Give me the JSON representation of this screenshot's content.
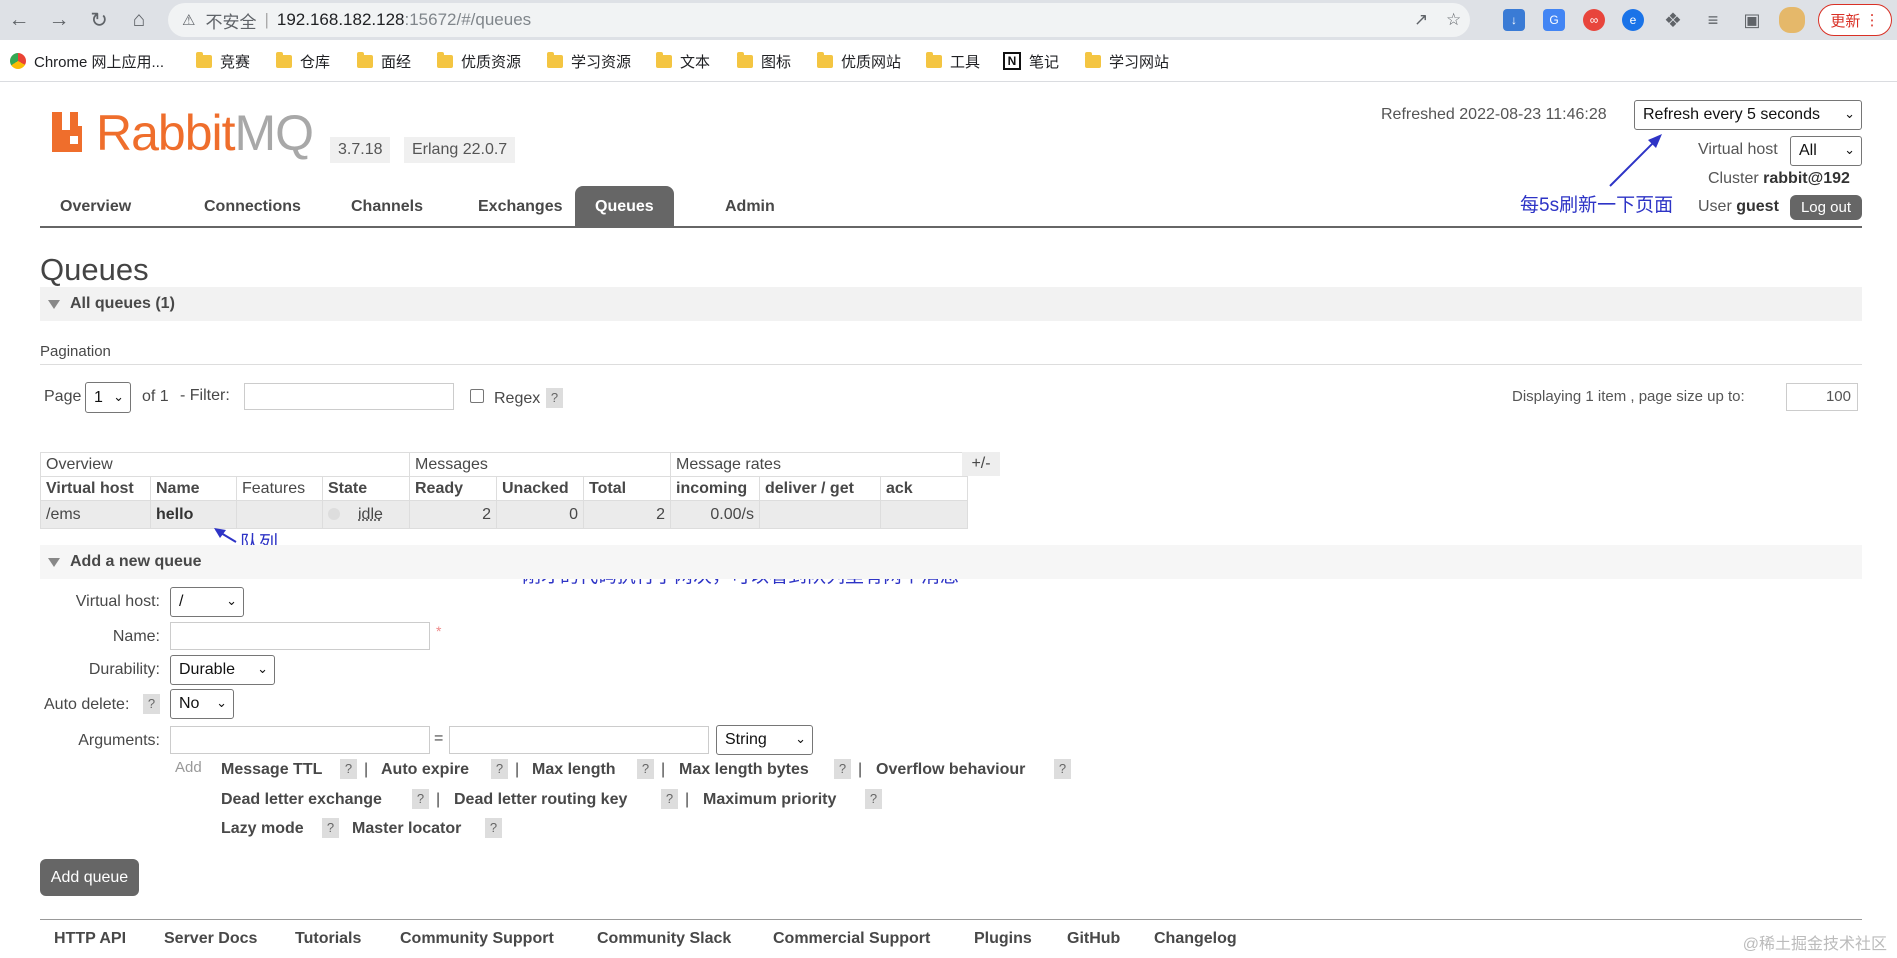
{
  "browser": {
    "insecure_label": "不安全",
    "url_host": "192.168.182.128",
    "url_path": ":15672/#/queues",
    "update_label": "更新",
    "bookmarks": [
      "Chrome 网上应用...",
      "竞赛",
      "仓库",
      "面经",
      "优质资源",
      "学习资源",
      "文本",
      "图标",
      "优质网站",
      "工具",
      "笔记",
      "学习网站"
    ]
  },
  "header": {
    "logo_text_a": "Rabbit",
    "logo_text_b": "MQ",
    "version": "3.7.18",
    "erlang": "Erlang 22.0.7",
    "refreshed": "Refreshed 2022-08-23 11:46:28",
    "refresh_select": "Refresh every 5 seconds",
    "vhost_label": "Virtual host",
    "vhost_value": "All",
    "cluster_label": "Cluster",
    "cluster_value": "rabbit@192",
    "user_label": "User",
    "user_value": "guest",
    "logout_label": "Log out"
  },
  "tabs": [
    "Overview",
    "Connections",
    "Channels",
    "Exchanges",
    "Queues",
    "Admin"
  ],
  "page_title": "Queues",
  "all_queues_label": "All queues (1)",
  "pagination": {
    "title": "Pagination",
    "page_label": "Page",
    "page_value": "1",
    "of_label": "of 1",
    "filter_label": "- Filter:",
    "regex_label": "Regex",
    "help": "?",
    "displaying": "Displaying 1 item , page size up to:",
    "page_size": "100"
  },
  "table": {
    "groups": [
      "Overview",
      "Messages",
      "Message rates"
    ],
    "headers": [
      "Virtual host",
      "Name",
      "Features",
      "State",
      "Ready",
      "Unacked",
      "Total",
      "incoming",
      "deliver / get",
      "ack"
    ],
    "rows": [
      {
        "vhost": "/ems",
        "name": "hello",
        "features": "",
        "state": "idle",
        "ready": "2",
        "unacked": "0",
        "total": "2",
        "incoming": "0.00/s",
        "deliver_get": "",
        "ack": ""
      }
    ],
    "toggle": "+/-"
  },
  "annotations": {
    "refresh_note": "每5s刷新一下页面",
    "queue_note": "队列",
    "message_note": "刚才的代码执行了两次，可以看到队列里有两个消息"
  },
  "add_queue": {
    "title": "Add a new queue",
    "vhost_label": "Virtual host:",
    "vhost_value": "/",
    "name_label": "Name:",
    "required_mark": "*",
    "durability_label": "Durability:",
    "durability_value": "Durable",
    "autodelete_label": "Auto delete:",
    "autodelete_value": "No",
    "arguments_label": "Arguments:",
    "equals": "=",
    "type_value": "String",
    "add_label": "Add",
    "arg_links": [
      "Message TTL",
      "Auto expire",
      "Max length",
      "Max length bytes",
      "Overflow behaviour",
      "Dead letter exchange",
      "Dead letter routing key",
      "Maximum priority",
      "Lazy mode",
      "Master locator"
    ],
    "submit_label": "Add queue"
  },
  "footer": {
    "links": [
      "HTTP API",
      "Server Docs",
      "Tutorials",
      "Community Support",
      "Community Slack",
      "Commercial Support",
      "Plugins",
      "GitHub",
      "Changelog"
    ],
    "watermark": "@稀土掘金技术社区"
  }
}
